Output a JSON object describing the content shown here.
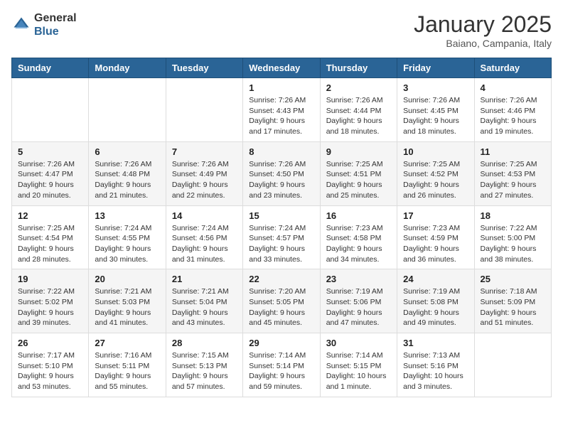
{
  "header": {
    "logo_general": "General",
    "logo_blue": "Blue",
    "month": "January 2025",
    "location": "Baiano, Campania, Italy"
  },
  "weekdays": [
    "Sunday",
    "Monday",
    "Tuesday",
    "Wednesday",
    "Thursday",
    "Friday",
    "Saturday"
  ],
  "weeks": [
    [
      {
        "day": "",
        "info": ""
      },
      {
        "day": "",
        "info": ""
      },
      {
        "day": "",
        "info": ""
      },
      {
        "day": "1",
        "info": "Sunrise: 7:26 AM\nSunset: 4:43 PM\nDaylight: 9 hours\nand 17 minutes."
      },
      {
        "day": "2",
        "info": "Sunrise: 7:26 AM\nSunset: 4:44 PM\nDaylight: 9 hours\nand 18 minutes."
      },
      {
        "day": "3",
        "info": "Sunrise: 7:26 AM\nSunset: 4:45 PM\nDaylight: 9 hours\nand 18 minutes."
      },
      {
        "day": "4",
        "info": "Sunrise: 7:26 AM\nSunset: 4:46 PM\nDaylight: 9 hours\nand 19 minutes."
      }
    ],
    [
      {
        "day": "5",
        "info": "Sunrise: 7:26 AM\nSunset: 4:47 PM\nDaylight: 9 hours\nand 20 minutes."
      },
      {
        "day": "6",
        "info": "Sunrise: 7:26 AM\nSunset: 4:48 PM\nDaylight: 9 hours\nand 21 minutes."
      },
      {
        "day": "7",
        "info": "Sunrise: 7:26 AM\nSunset: 4:49 PM\nDaylight: 9 hours\nand 22 minutes."
      },
      {
        "day": "8",
        "info": "Sunrise: 7:26 AM\nSunset: 4:50 PM\nDaylight: 9 hours\nand 23 minutes."
      },
      {
        "day": "9",
        "info": "Sunrise: 7:25 AM\nSunset: 4:51 PM\nDaylight: 9 hours\nand 25 minutes."
      },
      {
        "day": "10",
        "info": "Sunrise: 7:25 AM\nSunset: 4:52 PM\nDaylight: 9 hours\nand 26 minutes."
      },
      {
        "day": "11",
        "info": "Sunrise: 7:25 AM\nSunset: 4:53 PM\nDaylight: 9 hours\nand 27 minutes."
      }
    ],
    [
      {
        "day": "12",
        "info": "Sunrise: 7:25 AM\nSunset: 4:54 PM\nDaylight: 9 hours\nand 28 minutes."
      },
      {
        "day": "13",
        "info": "Sunrise: 7:24 AM\nSunset: 4:55 PM\nDaylight: 9 hours\nand 30 minutes."
      },
      {
        "day": "14",
        "info": "Sunrise: 7:24 AM\nSunset: 4:56 PM\nDaylight: 9 hours\nand 31 minutes."
      },
      {
        "day": "15",
        "info": "Sunrise: 7:24 AM\nSunset: 4:57 PM\nDaylight: 9 hours\nand 33 minutes."
      },
      {
        "day": "16",
        "info": "Sunrise: 7:23 AM\nSunset: 4:58 PM\nDaylight: 9 hours\nand 34 minutes."
      },
      {
        "day": "17",
        "info": "Sunrise: 7:23 AM\nSunset: 4:59 PM\nDaylight: 9 hours\nand 36 minutes."
      },
      {
        "day": "18",
        "info": "Sunrise: 7:22 AM\nSunset: 5:00 PM\nDaylight: 9 hours\nand 38 minutes."
      }
    ],
    [
      {
        "day": "19",
        "info": "Sunrise: 7:22 AM\nSunset: 5:02 PM\nDaylight: 9 hours\nand 39 minutes."
      },
      {
        "day": "20",
        "info": "Sunrise: 7:21 AM\nSunset: 5:03 PM\nDaylight: 9 hours\nand 41 minutes."
      },
      {
        "day": "21",
        "info": "Sunrise: 7:21 AM\nSunset: 5:04 PM\nDaylight: 9 hours\nand 43 minutes."
      },
      {
        "day": "22",
        "info": "Sunrise: 7:20 AM\nSunset: 5:05 PM\nDaylight: 9 hours\nand 45 minutes."
      },
      {
        "day": "23",
        "info": "Sunrise: 7:19 AM\nSunset: 5:06 PM\nDaylight: 9 hours\nand 47 minutes."
      },
      {
        "day": "24",
        "info": "Sunrise: 7:19 AM\nSunset: 5:08 PM\nDaylight: 9 hours\nand 49 minutes."
      },
      {
        "day": "25",
        "info": "Sunrise: 7:18 AM\nSunset: 5:09 PM\nDaylight: 9 hours\nand 51 minutes."
      }
    ],
    [
      {
        "day": "26",
        "info": "Sunrise: 7:17 AM\nSunset: 5:10 PM\nDaylight: 9 hours\nand 53 minutes."
      },
      {
        "day": "27",
        "info": "Sunrise: 7:16 AM\nSunset: 5:11 PM\nDaylight: 9 hours\nand 55 minutes."
      },
      {
        "day": "28",
        "info": "Sunrise: 7:15 AM\nSunset: 5:13 PM\nDaylight: 9 hours\nand 57 minutes."
      },
      {
        "day": "29",
        "info": "Sunrise: 7:14 AM\nSunset: 5:14 PM\nDaylight: 9 hours\nand 59 minutes."
      },
      {
        "day": "30",
        "info": "Sunrise: 7:14 AM\nSunset: 5:15 PM\nDaylight: 10 hours\nand 1 minute."
      },
      {
        "day": "31",
        "info": "Sunrise: 7:13 AM\nSunset: 5:16 PM\nDaylight: 10 hours\nand 3 minutes."
      },
      {
        "day": "",
        "info": ""
      }
    ]
  ]
}
